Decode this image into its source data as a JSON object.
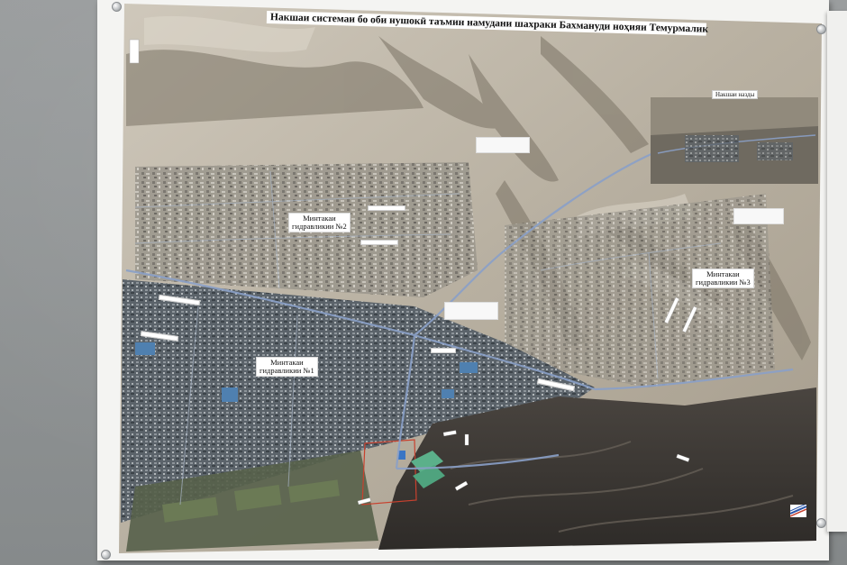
{
  "poster": {
    "title": "Накшаи системаи бо оби нушокӣ таъмин намудани шахраки Бахмануди ноҳияи Темурмалик"
  },
  "inset": {
    "label": "Накшаи назды"
  },
  "zones": [
    {
      "line1": "Минтакаи",
      "line2": "гидравликии №2"
    },
    {
      "line1": "Минтакаи",
      "line2": "гидравликии №1"
    },
    {
      "line1": "Минтакаи",
      "line2": "гидравликии №3"
    }
  ],
  "colors": {
    "terrain": "#bfb7a8",
    "shadow": "#6e665b",
    "town": "#5a6570",
    "road": "#8aa0c8",
    "reservoir": "#5bb08a",
    "plot_outline": "#c8412e",
    "frame": "#f4f4f2"
  },
  "icons": {
    "logo": "flag-stripes-logo"
  }
}
